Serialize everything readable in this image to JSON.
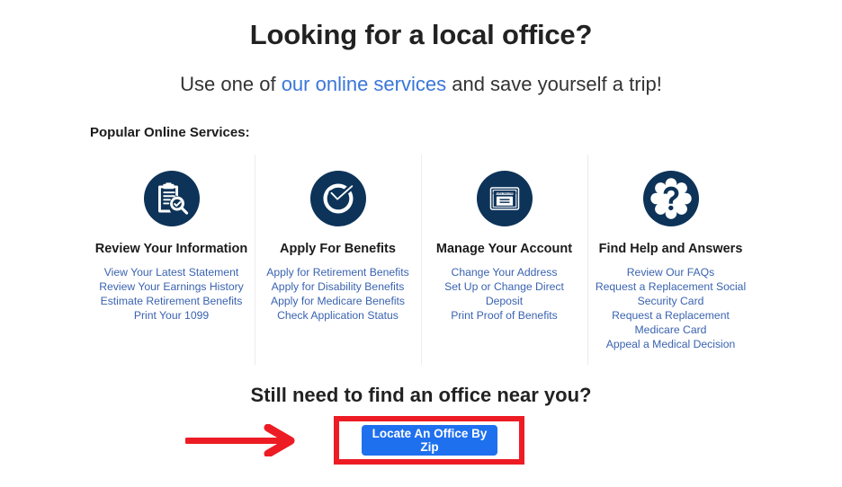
{
  "heading": "Looking for a local office?",
  "subheading": {
    "before": "Use one of ",
    "link": "our online services",
    "after": " and save yourself a trip!"
  },
  "section_label": "Popular Online Services:",
  "services": [
    {
      "icon": "clipboard-magnifier-icon",
      "title": "Review Your Information",
      "links": [
        "View Your Latest Statement",
        "Review Your Earnings History",
        "Estimate Retirement Benefits",
        "Print Your 1099"
      ]
    },
    {
      "icon": "check-circle-icon",
      "title": "Apply For Benefits",
      "links": [
        "Apply for Retirement Benefits",
        "Apply for Disability Benefits",
        "Apply for Medicare Benefits",
        "Check Application Status"
      ]
    },
    {
      "icon": "social-security-card-icon",
      "title": "Manage Your Account",
      "links": [
        "Change Your Address",
        "Set Up or Change Direct Deposit",
        "Print Proof of Benefits"
      ]
    },
    {
      "icon": "question-mark-cloud-icon",
      "title": "Find Help and Answers",
      "links": [
        "Review Our FAQs",
        "Request a Replacement Social Security Card",
        "Request a Replacement Medicare Card",
        "Appeal a Medical Decision"
      ]
    }
  ],
  "cta": {
    "heading": "Still need to find an office near you?",
    "button_label": "Locate An Office By Zip"
  },
  "annotations": {
    "highlight_color": "#ed1c24",
    "arrow": "right-arrow-annotation"
  },
  "colors": {
    "icon_navy": "#0d3359",
    "link_blue": "#3a63b0",
    "header_link_blue": "#3a76d8",
    "button_blue": "#1f70ee",
    "annotation_red": "#ed1c24"
  }
}
